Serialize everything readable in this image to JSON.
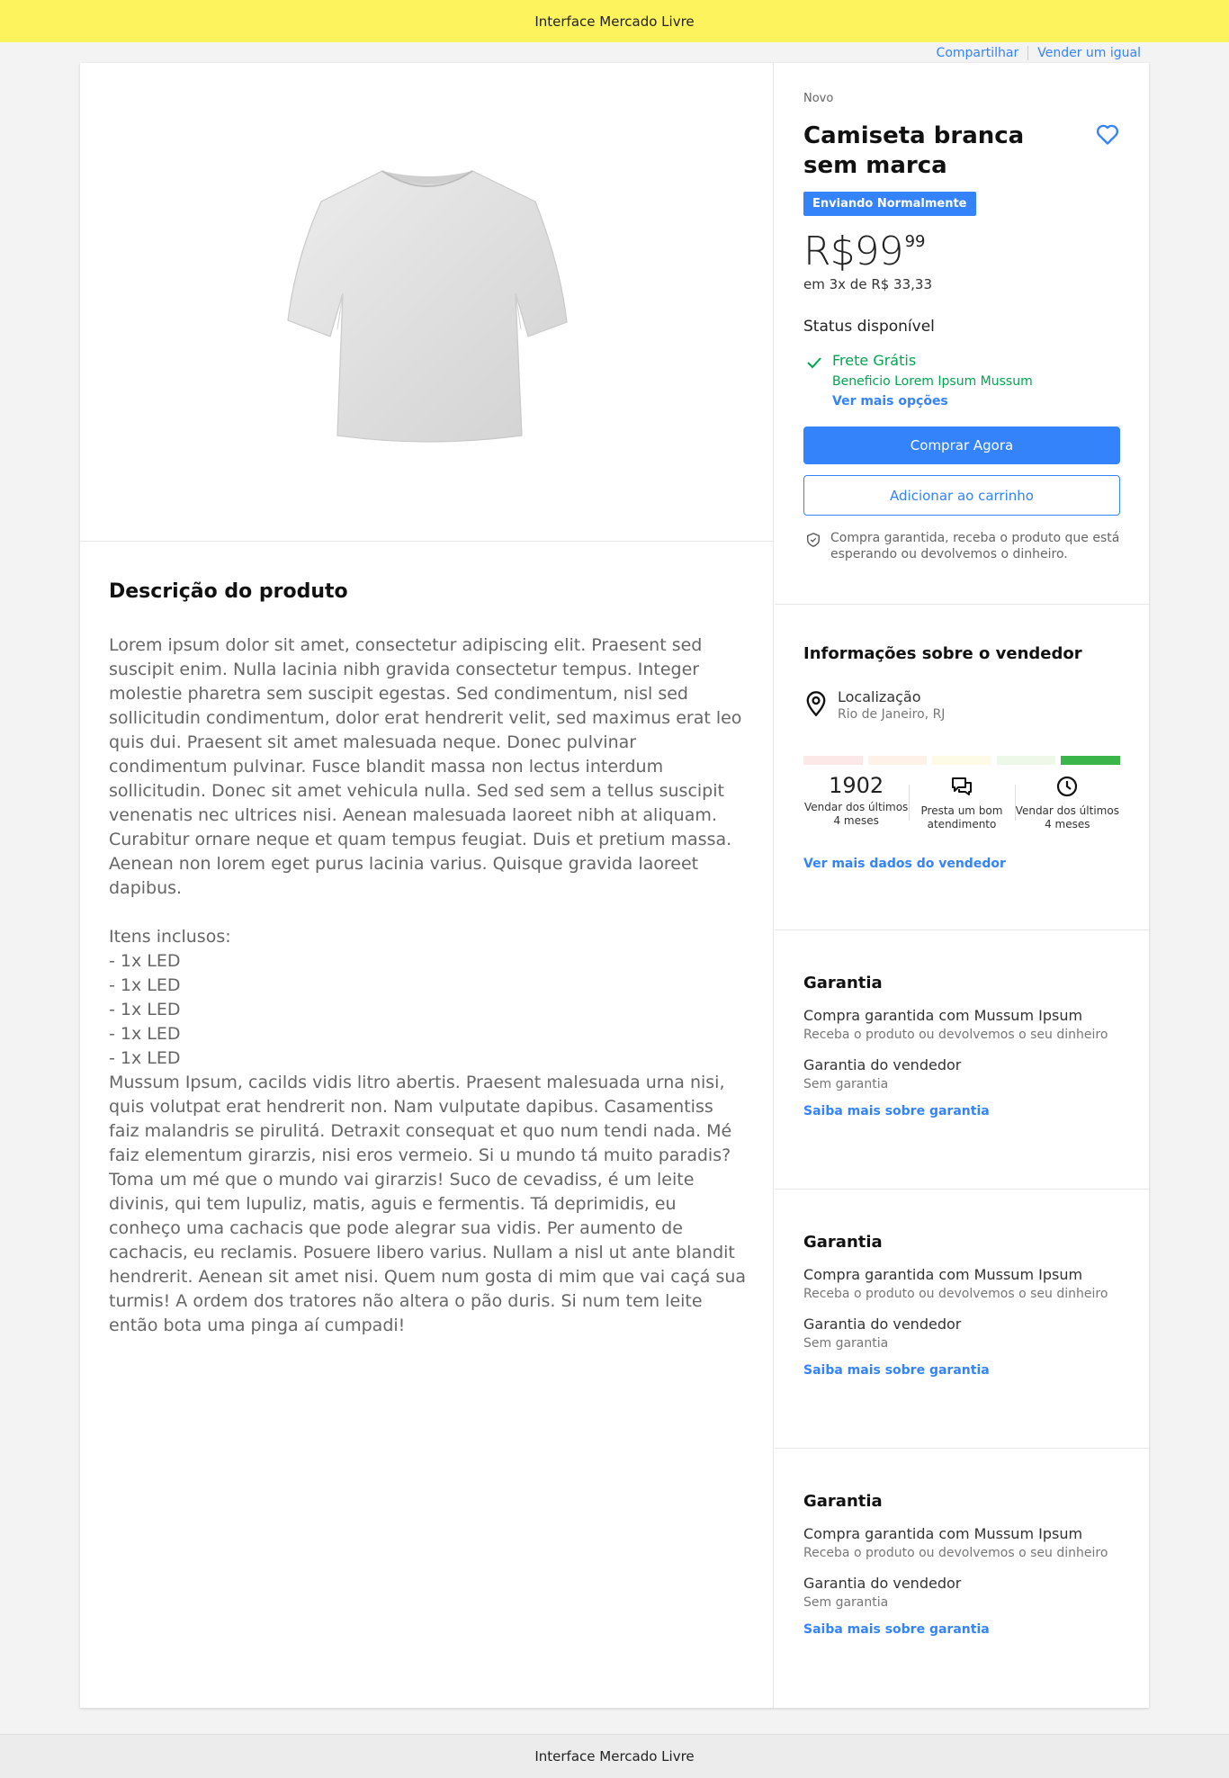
{
  "header": {
    "title": "Interface Mercado Livre"
  },
  "top_links": [
    "Compartilhar",
    "Vender um igual"
  ],
  "product": {
    "image_icon": "tshirt-image",
    "condition": "Novo",
    "title": "Camiseta branca sem marca",
    "badge": "Enviando Normalmente",
    "price_main": "R$99",
    "price_cents": "99",
    "installments": "em 3x de R$ 33,33",
    "status": "Status disponível",
    "shipping": {
      "free": "Frete Grátis",
      "benefit": "Beneficio Lorem Ipsum Mussum",
      "more": "Ver mais opções"
    },
    "buy_now": "Comprar Agora",
    "add_to_cart": "Adicionar ao carrinho",
    "guarantee_note": "Compra garantida, receba o produto que está esperando ou devolvemos o dinheiro."
  },
  "description": {
    "title": "Descrição do produto",
    "text": "Lorem ipsum dolor sit amet, consectetur adipiscing elit. Praesent sed suscipit enim. Nulla lacinia nibh gravida consectetur tempus. Integer molestie pharetra sem suscipit egestas. Sed condimentum, nisl sed sollicitudin condimentum, dolor erat hendrerit velit, sed maximus erat leo quis dui. Praesent sit amet malesuada neque. Donec pulvinar condimentum pulvinar. Fusce blandit massa non lectus interdum sollicitudin. Donec sit amet vehicula nulla. Sed sed sem a tellus suscipit venenatis nec ultrices nisi. Aenean malesuada laoreet nibh at aliquam. Curabitur ornare neque et quam tempus feugiat. Duis et pretium massa. Aenean non lorem eget purus lacinia varius. Quisque gravida laoreet dapibus.\n\nItens inclusos:\n- 1x LED\n- 1x LED\n- 1x LED\n- 1x LED\n- 1x LED\nMussum Ipsum, cacilds vidis litro abertis. Praesent malesuada urna nisi, quis volutpat erat hendrerit non. Nam vulputate dapibus. Casamentiss faiz malandris se pirulitá. Detraxit consequat et quo num tendi nada. Mé faiz elementum girarzis, nisi eros vermeio. Si u mundo tá muito paradis? Toma um mé que o mundo vai girarzis! Suco de cevadiss, é um leite divinis, qui tem lupuliz, matis, aguis e fermentis. Tá deprimidis, eu conheço uma cachacis que pode alegrar sua vidis. Per aumento de cachacis, eu reclamis. Posuere libero varius. Nullam a nisl ut ante blandit hendrerit. Aenean sit amet nisi. Quem num gosta di mim que vai caçá sua turmis! A ordem dos tratores não altera o pão duris. Si num tem leite então bota uma pinga aí cumpadi!"
  },
  "seller": {
    "title": "Informações sobre o vendedor",
    "location_label": "Localização",
    "location_value": "Rio de Janeiro, RJ",
    "reputation_colors": [
      "#fde8e8",
      "#fdf1e8",
      "#fdfbe6",
      "#eef8e8",
      "#39b54a"
    ],
    "stats": [
      {
        "value": "1902",
        "label": "Vendar dos últimos 4 meses"
      },
      {
        "icon": "chat-icon",
        "label": "Presta um bom atendimento"
      },
      {
        "icon": "clock-icon",
        "label": "Vendar dos últimos 4 meses"
      }
    ],
    "more_link": "Ver mais dados do vendedor"
  },
  "warranties": [
    {
      "title": "Garantia",
      "item1_title": "Compra garantida com Mussum Ipsum",
      "item1_sub": "Receba o produto ou devolvemos o seu dinheiro",
      "item2_title": "Garantia do vendedor",
      "item2_sub": "Sem garantia",
      "link": "Saiba mais sobre garantia"
    },
    {
      "title": "Garantia",
      "item1_title": "Compra garantida com Mussum Ipsum",
      "item1_sub": "Receba o produto ou devolvemos o seu dinheiro",
      "item2_title": "Garantia do vendedor",
      "item2_sub": "Sem garantia",
      "link": "Saiba mais sobre garantia"
    },
    {
      "title": "Garantia",
      "item1_title": "Compra garantida com Mussum Ipsum",
      "item1_sub": "Receba o produto ou devolvemos o seu dinheiro",
      "item2_title": "Garantia do vendedor",
      "item2_sub": "Sem garantia",
      "link": "Saiba mais sobre garantia"
    }
  ],
  "footer": {
    "text": "Interface Mercado Livre"
  },
  "colors": {
    "accent": "#3483fa",
    "header_bg": "#fdf35d",
    "success": "#00a650"
  }
}
